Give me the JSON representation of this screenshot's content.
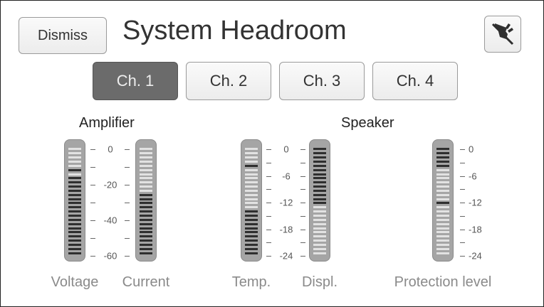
{
  "header": {
    "dismiss_label": "Dismiss",
    "title": "System Headroom",
    "mute_icon": "speaker-mute-icon"
  },
  "tabs": [
    {
      "label": "Ch. 1",
      "active": true
    },
    {
      "label": "Ch. 2",
      "active": false
    },
    {
      "label": "Ch. 3",
      "active": false
    },
    {
      "label": "Ch. 4",
      "active": false
    }
  ],
  "sections": {
    "amplifier": "Amplifier",
    "speaker": "Speaker"
  },
  "scales": {
    "amp": [
      "0",
      "-20",
      "-40",
      "-60"
    ],
    "speaker": [
      "0",
      "-6",
      "-12",
      "-18",
      "-24"
    ]
  },
  "meters": {
    "voltage": {
      "label": "Voltage",
      "fill_fraction": 0.72,
      "peak_fraction": 0.76
    },
    "current": {
      "label": "Current",
      "fill_fraction": 0.57,
      "peak_fraction": null
    },
    "temp": {
      "label": "Temp.",
      "fill_fraction": 0.43,
      "peak_fraction": 0.8
    },
    "displ": {
      "label": "Displ.",
      "fill_fraction": 0.55,
      "peak_fraction": 0.45,
      "fill_from_top": true
    },
    "protection": {
      "label": "Protection level",
      "fill_fraction": 0.2,
      "peak_fraction": 0.5,
      "fill_from_top": true
    }
  },
  "colors": {
    "lit": "#2f2f2f",
    "unlit": "#e2e2e2",
    "peak": "#2f2f2f",
    "active_tab": "#6b6b6b"
  }
}
